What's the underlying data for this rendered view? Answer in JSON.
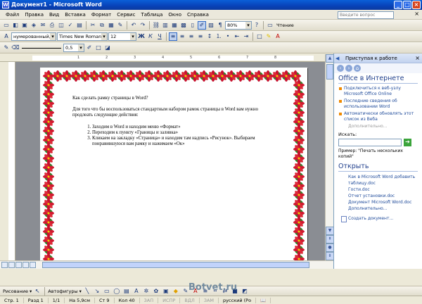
{
  "window": {
    "title": "Документ1 - Microsoft Word",
    "icon": "word-app-icon"
  },
  "menu": {
    "items": [
      "Файл",
      "Правка",
      "Вид",
      "Вставка",
      "Формат",
      "Сервис",
      "Таблица",
      "Окно",
      "Справка"
    ],
    "help_placeholder": "Введите вопрос"
  },
  "toolbar_standard": {
    "zoom": "80%",
    "read_label": "Чтение"
  },
  "toolbar_format": {
    "style": "нумерованный,",
    "font": "Times New Roman",
    "size": "12"
  },
  "toolbar_border": {
    "line_width": "0,5"
  },
  "document": {
    "line1": "Как сделать рамку страницы в Word?",
    "para": "Для того что бы воспользоваться стандартным набором рамок страницы в Word вам нужно продлеать следующие действия:",
    "list": [
      "Заходим в Word и находим меню «Формат»",
      "Переходим к пункту «Границы и заливка»",
      "Кликаем на закладку «Страница» и находим там надпись «Рисунок». Выбираем понравившуюся вам рамку и нажимаем «Ок»"
    ]
  },
  "taskpane": {
    "header": "Приступая к работе",
    "office_title": "Office в Интернете",
    "bullets": [
      "Подключиться к веб-узлу Microsoft Office Online",
      "Последние сведения об использовании Word",
      "Автоматически обновлять этот список из Веба"
    ],
    "more": "Дополнительно...",
    "search_label": "Искать:",
    "example": "Пример: \"Печать нескольких копий\"",
    "open_title": "Открыть",
    "docs": [
      "Как в Microsoft Word добавить таблицу.doc",
      "Гости.doc",
      "Отчет установки.doc",
      "Документ Microsoft Word.doc"
    ],
    "more2": "Дополнительно...",
    "create": "Создать документ..."
  },
  "drawbar": {
    "drawing": "Рисование",
    "autoshapes": "Автофигуры"
  },
  "statusbar": {
    "page": "Стр. 1",
    "section": "Разд 1",
    "pages": "1/1",
    "at": "На 5,9см",
    "line": "Ст 9",
    "col": "Кол 40",
    "rec": "ЗАП",
    "trk": "ИСПР",
    "ext": "ВДЛ",
    "ovr": "ЗАМ",
    "lang": "русский (Ро"
  },
  "watermark": "Botvet.ru",
  "colors": {
    "title_blue": "#0842b8",
    "link_blue": "#1e4a9a",
    "flower_red": "#c8102e",
    "leaf_green": "#2a8a2a"
  }
}
